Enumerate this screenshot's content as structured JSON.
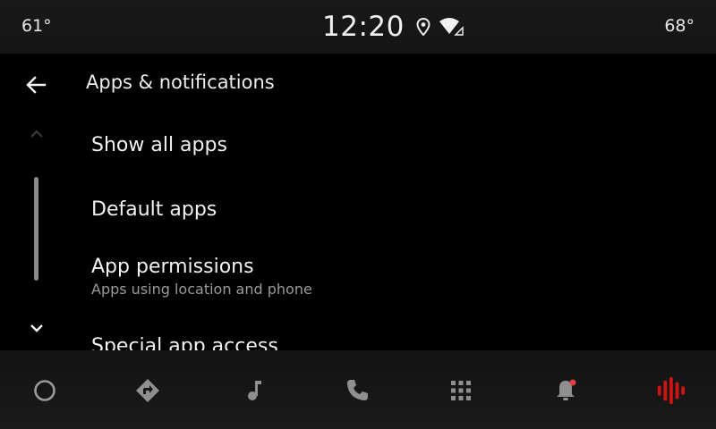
{
  "status_bar": {
    "outside_temp": "61°",
    "time": "12:20",
    "inside_temp": "68°"
  },
  "app_bar": {
    "title": "Apps & notifications",
    "back_icon": "arrow-back-icon"
  },
  "settings_list": [
    {
      "label": "Show all apps",
      "sublabel": ""
    },
    {
      "label": "Default apps",
      "sublabel": ""
    },
    {
      "label": "App permissions",
      "sublabel": "Apps using location and phone"
    },
    {
      "label": "Special app access",
      "sublabel": ""
    }
  ],
  "nav_bar": {
    "items": [
      "home-circle-icon",
      "navigation-icon",
      "music-note-icon",
      "phone-icon",
      "app-grid-icon",
      "notification-bell-icon",
      "voice-assistant-icon"
    ]
  },
  "colors": {
    "background": "#000000",
    "bar_background": "#161616",
    "notification_dot": "#e04040",
    "voice_accent": "#d01414"
  }
}
